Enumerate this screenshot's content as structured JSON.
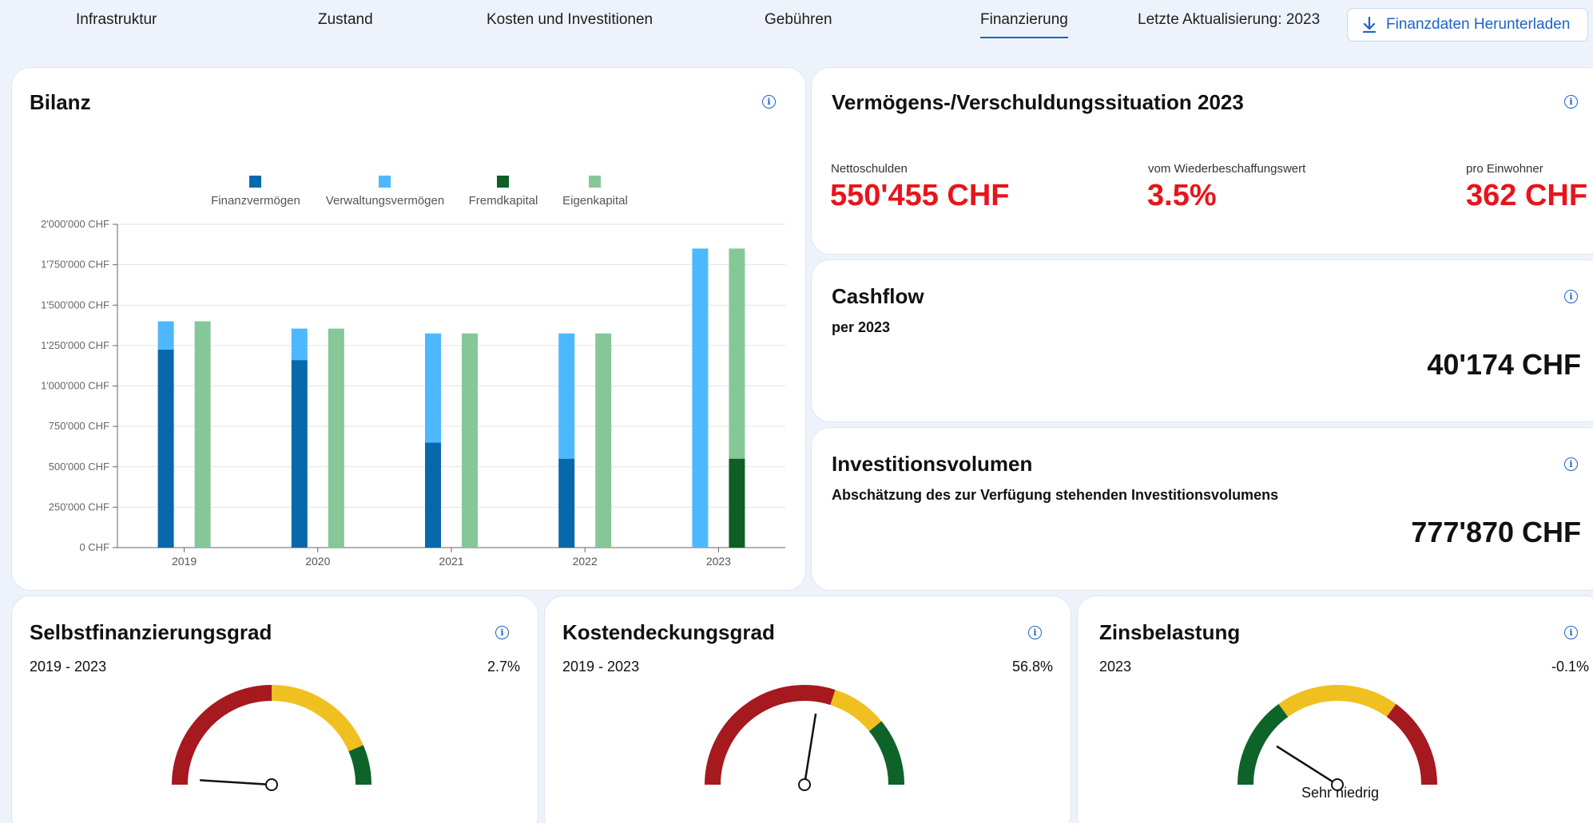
{
  "nav": {
    "tabs": [
      {
        "label": "Infrastruktur"
      },
      {
        "label": "Zustand"
      },
      {
        "label": "Kosten und Investitionen"
      },
      {
        "label": "Gebühren"
      },
      {
        "label": "Finanzierung",
        "active": true
      }
    ],
    "update_text": "Letzte Aktualisierung: 2023",
    "download_label": "Finanzdaten Herunterladen",
    "download_icon": "download-arrow-icon"
  },
  "bilanz": {
    "title": "Bilanz",
    "chart_data": {
      "type": "bar",
      "categories": [
        "2019",
        "2020",
        "2021",
        "2022",
        "2023"
      ],
      "series": [
        {
          "name": "Finanzvermögen",
          "color": "#0868ac",
          "stack": "aktiva",
          "values": [
            1225000,
            1160000,
            650000,
            550000,
            0
          ]
        },
        {
          "name": "Verwaltungsvermögen",
          "color": "#4db8ff",
          "stack": "aktiva",
          "values": [
            175000,
            195000,
            675000,
            775000,
            1850000
          ]
        },
        {
          "name": "Fremdkapital",
          "color": "#0e5e25",
          "stack": "passiva",
          "values": [
            0,
            0,
            0,
            0,
            550000
          ]
        },
        {
          "name": "Eigenkapital",
          "color": "#86c799",
          "stack": "passiva",
          "values": [
            1400000,
            1355000,
            1325000,
            1325000,
            1300000
          ]
        }
      ],
      "ylim": [
        0,
        2000000
      ],
      "yticks": [
        "0 CHF",
        "250'000 CHF",
        "500'000 CHF",
        "750'000 CHF",
        "1'000'000 CHF",
        "1'250'000 CHF",
        "1'500'000 CHF",
        "1'750'000 CHF",
        "2'000'000 CHF"
      ],
      "grid": true,
      "legend": "top"
    }
  },
  "vermoegen": {
    "title": "Vermögens-/Verschuldungssituation 2023",
    "stats": [
      {
        "label": "Nettoschulden",
        "value": "550'455 CHF"
      },
      {
        "label": "vom Wiederbeschaffungswert",
        "value": "3.5%"
      },
      {
        "label": "pro Einwohner",
        "value": "362 CHF"
      }
    ],
    "value_color": "#e8141b"
  },
  "cashflow": {
    "title": "Cashflow",
    "subtitle": "per 2023",
    "value": "40'174 CHF"
  },
  "investition": {
    "title": "Investitionsvolumen",
    "subtitle": "Abschätzung des zur Verfügung stehenden Investitionsvolumens",
    "value": "777'870 CHF"
  },
  "gauges": [
    {
      "title": "Selbstfinanzierungsgrad",
      "period": "2019 - 2023",
      "value": "2.7%",
      "needle_fraction": 0.02,
      "segments": [
        {
          "color": "#a6191f",
          "to": 0.5
        },
        {
          "color": "#f0c020",
          "to": 0.87
        },
        {
          "color": "#0e6328",
          "to": 1
        }
      ],
      "caption": ""
    },
    {
      "title": "Kostendeckungsgrad",
      "period": "2019 - 2023",
      "value": "56.8%",
      "needle_fraction": 0.55,
      "segments": [
        {
          "color": "#a6191f",
          "to": 0.6
        },
        {
          "color": "#f0c020",
          "to": 0.78
        },
        {
          "color": "#0e6328",
          "to": 1
        }
      ],
      "caption": ""
    },
    {
      "title": "Zinsbelastung",
      "period": "2023",
      "value": "-0.1%",
      "needle_fraction": 0.18,
      "segments": [
        {
          "color": "#0e6328",
          "to": 0.3
        },
        {
          "color": "#f0c020",
          "to": 0.7
        },
        {
          "color": "#a6191f",
          "to": 1
        }
      ],
      "caption": "Sehr niedrig"
    }
  ],
  "info_icon": "info-icon",
  "accent": "#1a63c9"
}
